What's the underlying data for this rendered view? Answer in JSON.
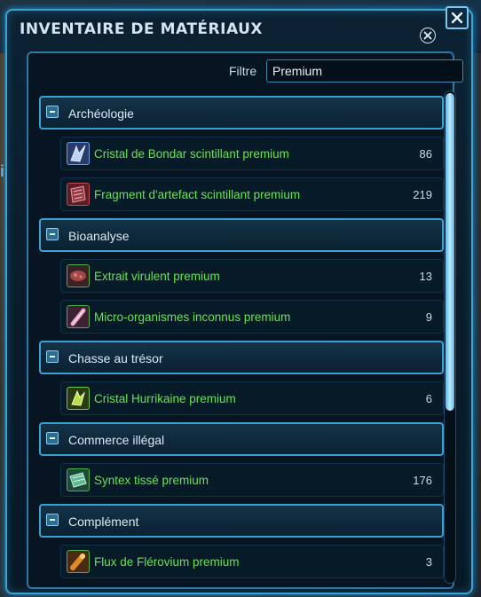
{
  "window": {
    "title": "INVENTAIRE DE MATÉRIAUX"
  },
  "filter": {
    "label": "Filtre",
    "value": "Premium"
  },
  "categories": [
    {
      "label": "Archéologie",
      "items": [
        {
          "name": "Cristal de Bondar scintillant premium",
          "count": "86",
          "icon": "crystal-icon"
        },
        {
          "name": "Fragment d'artefact scintillant premium",
          "count": "219",
          "icon": "artifact-fragment-icon"
        }
      ]
    },
    {
      "label": "Bioanalyse",
      "items": [
        {
          "name": "Extrait virulent premium",
          "count": "13",
          "icon": "extract-icon"
        },
        {
          "name": "Micro-organismes inconnus premium",
          "count": "9",
          "icon": "vial-icon"
        }
      ]
    },
    {
      "label": "Chasse au trésor",
      "items": [
        {
          "name": "Cristal Hurrikaine premium",
          "count": "6",
          "icon": "green-crystal-icon"
        }
      ]
    },
    {
      "label": "Commerce illégal",
      "items": [
        {
          "name": "Syntex tissé premium",
          "count": "176",
          "icon": "fabric-icon"
        }
      ]
    },
    {
      "label": "Complément",
      "items": [
        {
          "name": "Flux de Flérovium premium",
          "count": "3",
          "icon": "flux-icon"
        }
      ]
    }
  ],
  "colors": {
    "accent": "#3aa0d2",
    "item_text": "#5fe84a",
    "title_text": "#cfe6f2"
  }
}
